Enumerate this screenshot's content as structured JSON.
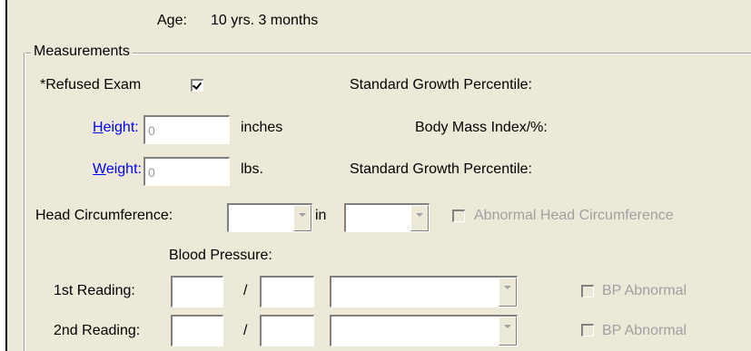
{
  "age": {
    "label": "Age:",
    "value": "10 yrs. 3 months"
  },
  "measurements": {
    "title": "Measurements",
    "refused_exam": {
      "label": "*Refused Exam",
      "checked": true
    },
    "height": {
      "label_prefix": "",
      "label_underline": "H",
      "label_rest": "eight:",
      "value": "0",
      "unit": "inches"
    },
    "weight": {
      "label_underline": "W",
      "label_rest": "eight:",
      "value": "0",
      "unit": "lbs."
    },
    "standard_growth_percentile_1": "Standard Growth Percentile:",
    "bmi_label": "Body Mass Index/%:",
    "standard_growth_percentile_2": "Standard Growth Percentile:",
    "head_circumference": {
      "label": "Head Circumference:",
      "unit": "in",
      "abnormal_label": "Abnormal Head Circumference",
      "abnormal_checked": false
    },
    "blood_pressure": {
      "title": "Blood Pressure:",
      "separator": "/",
      "readings": [
        {
          "label": "1st  Reading:",
          "abnormal_label": "BP Abnormal",
          "abnormal_checked": false
        },
        {
          "label": "2nd Reading:",
          "abnormal_label": "BP Abnormal",
          "abnormal_checked": false
        }
      ]
    }
  }
}
